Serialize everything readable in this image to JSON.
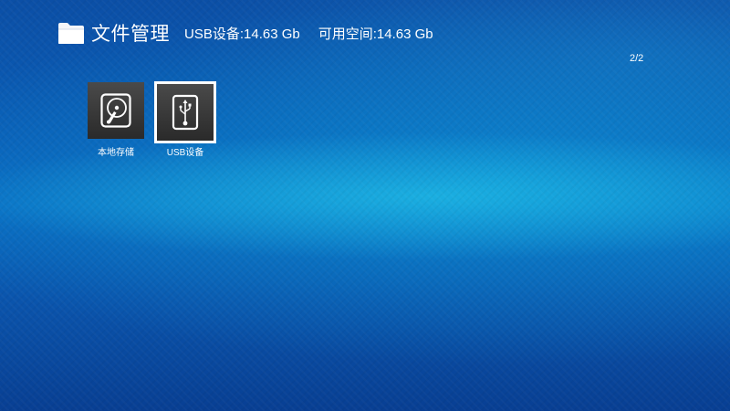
{
  "header": {
    "icon": "folder-icon",
    "title": "文件管理",
    "usb_info": "USB设备:14.63 Gb",
    "free_space": "可用空间:14.63 Gb"
  },
  "pagination": {
    "indicator": "2/2"
  },
  "devices": [
    {
      "icon": "hard-disk-icon",
      "label": "本地存储",
      "selected": false
    },
    {
      "icon": "usb-drive-icon",
      "label": "USB设备",
      "selected": true
    }
  ],
  "colors": {
    "background_top": "#0b4fa6",
    "background_glow": "#28d2f0",
    "tile_bg": "#2a2a2a",
    "selection_border": "#ffffff",
    "text": "#ffffff"
  }
}
